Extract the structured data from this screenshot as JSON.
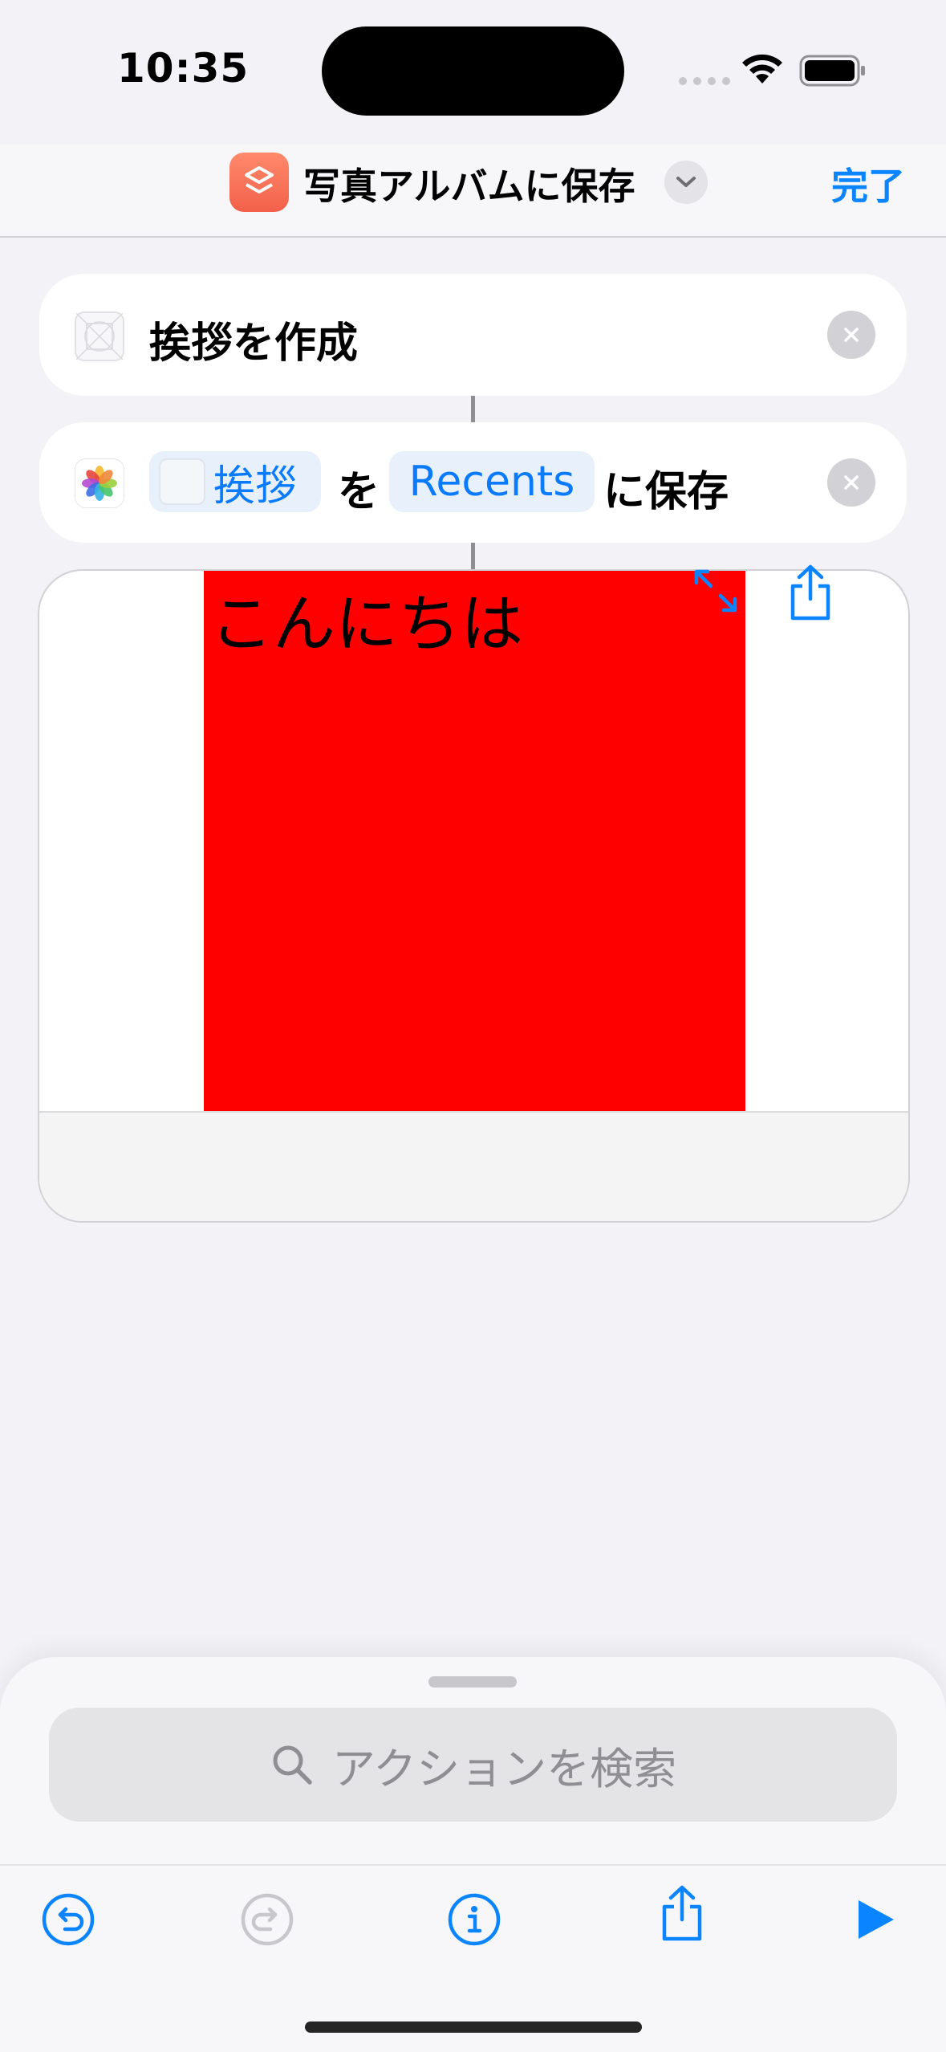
{
  "status_bar": {
    "time": "10:35",
    "icons": [
      "signal-dots-icon",
      "wifi-icon",
      "battery-icon"
    ]
  },
  "navbar": {
    "app_icon": "shortcuts-icon",
    "title": "写真アルバムに保存",
    "title_menu_icon": "chevron-down-icon",
    "done_label": "完了"
  },
  "actions": [
    {
      "icon": "placeholder-icon",
      "text": "挨拶を作成"
    },
    {
      "icon": "photos-icon",
      "input_token": "挨拶",
      "connector_1": "を",
      "album_token": "Recents",
      "connector_2": "に保存"
    }
  ],
  "preview": {
    "image_text": "こんにちは",
    "image_color": "#ff0000",
    "toolbar_icons": [
      "expand-icon",
      "share-icon"
    ]
  },
  "bottom_sheet": {
    "search_placeholder": "アクションを検索",
    "toolbar_icons": [
      "undo-icon",
      "redo-icon",
      "info-icon",
      "share-icon",
      "play-icon"
    ]
  },
  "colors": {
    "accent": "#0a84ff",
    "background": "#f2f2f7"
  }
}
